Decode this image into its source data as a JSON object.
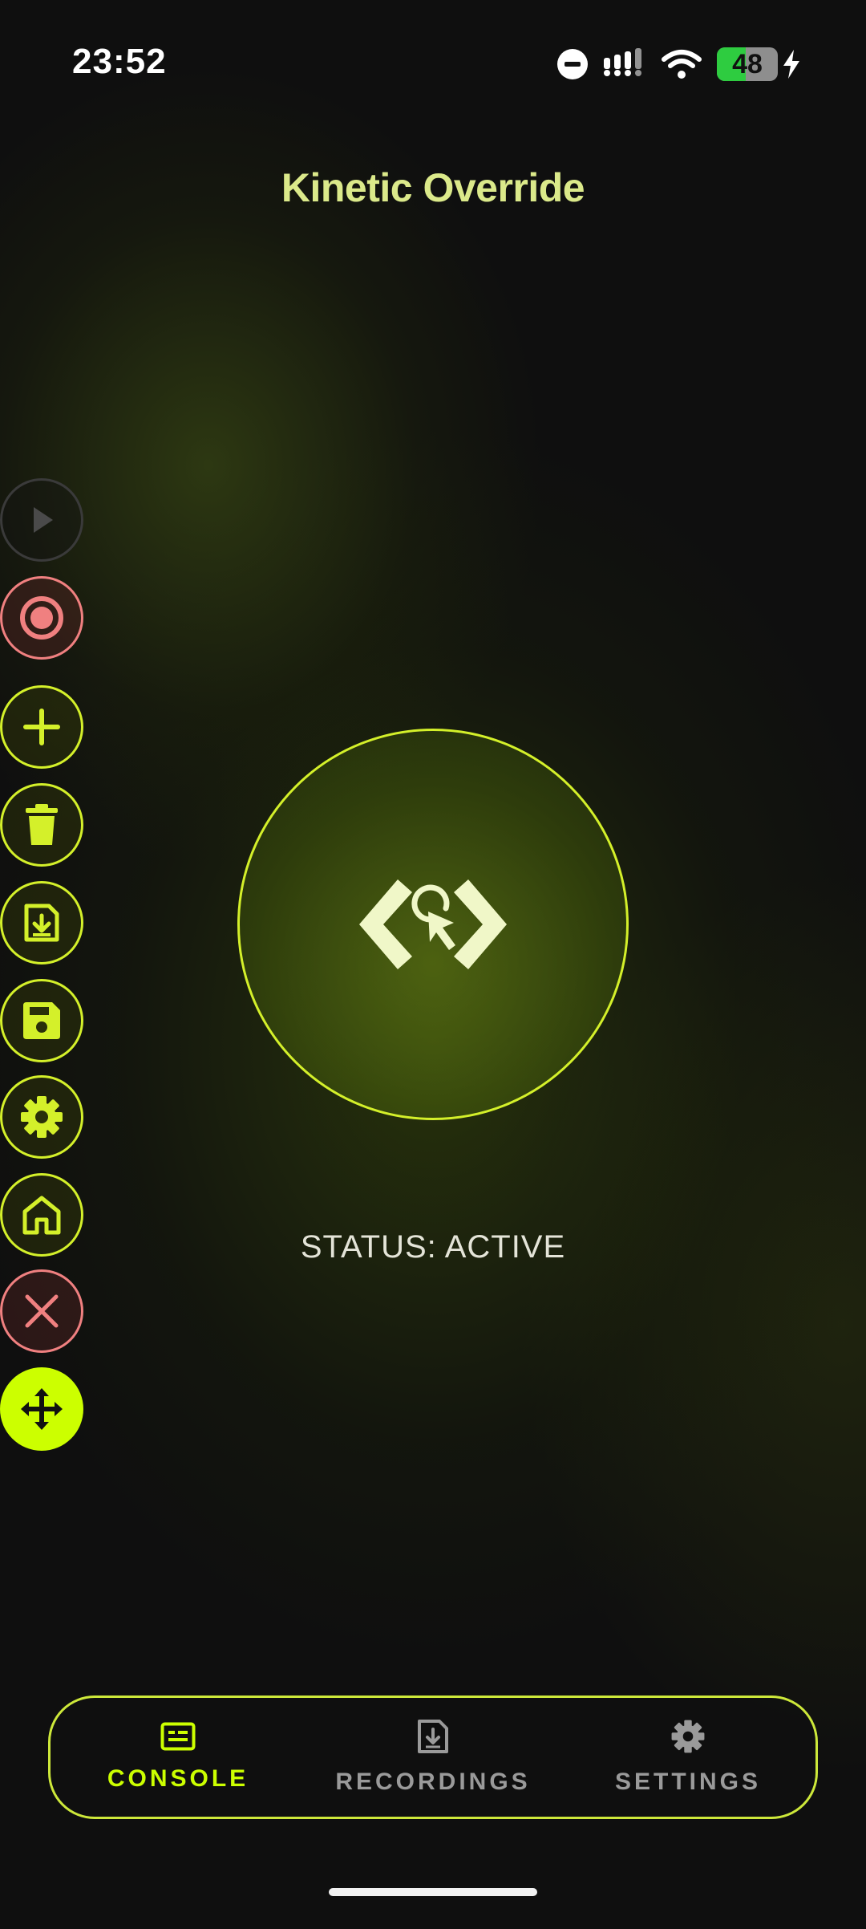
{
  "status_bar": {
    "time": "23:52",
    "battery_percent": "48",
    "battery_level": 0.48,
    "icons": [
      "do-not-disturb-icon",
      "signal-icon",
      "wifi-icon",
      "battery-icon",
      "charging-icon"
    ]
  },
  "app": {
    "title": "Kinetic Override"
  },
  "sidebar": {
    "buttons": [
      {
        "name": "play-icon",
        "style": "disabled"
      },
      {
        "name": "record-icon",
        "style": "red"
      },
      {
        "name": "plus-icon",
        "style": "lime"
      },
      {
        "name": "trash-icon",
        "style": "lime"
      },
      {
        "name": "import-icon",
        "style": "lime"
      },
      {
        "name": "save-icon",
        "style": "lime"
      },
      {
        "name": "gear-icon",
        "style": "lime"
      },
      {
        "name": "home-icon",
        "style": "lime"
      },
      {
        "name": "close-icon",
        "style": "red"
      },
      {
        "name": "move-icon",
        "style": "solid-lime"
      }
    ]
  },
  "main": {
    "center_icon": "code-cursor-icon",
    "status": "STATUS: ACTIVE"
  },
  "bottom_nav": {
    "items": [
      {
        "label": "CONSOLE",
        "icon": "console-icon",
        "active": true
      },
      {
        "label": "RECORDINGS",
        "icon": "recordings-icon",
        "active": false
      },
      {
        "label": "SETTINGS",
        "icon": "settings-icon",
        "active": false
      }
    ]
  },
  "colors": {
    "accent": "#ccff00",
    "accent_border": "#d4f02a",
    "danger": "#f08080",
    "title": "#dbe98a",
    "background": "#0f0f0f"
  }
}
